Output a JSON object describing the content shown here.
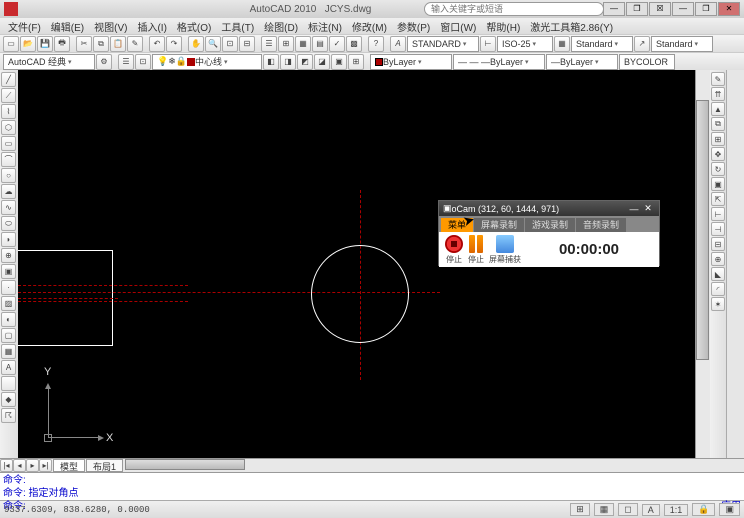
{
  "title": {
    "app": "AutoCAD 2010",
    "file": "JCYS.dwg"
  },
  "search": {
    "placeholder": "输入关键字或短语"
  },
  "menu": {
    "items": [
      "文件(F)",
      "编辑(E)",
      "视图(V)",
      "插入(I)",
      "格式(O)",
      "工具(T)",
      "绘图(D)",
      "标注(N)",
      "修改(M)",
      "参数(P)",
      "窗口(W)",
      "帮助(H)",
      "激光工具箱2.86(Y)"
    ]
  },
  "toolbar2": {
    "workspace": "AutoCAD 经典",
    "layer": "中心线",
    "bylayer1": "ByLayer",
    "bylayer2": "ByLayer",
    "bylayer3": "ByLayer",
    "bycolor": "BYCOLOR"
  },
  "styles": {
    "text": "STANDARD",
    "dim": "ISO-25",
    "table": "Standard",
    "mleader": "Standard"
  },
  "tabs": {
    "model": "模型",
    "layout1": "布局1"
  },
  "cmd": {
    "l1": "命令:",
    "l2": "命令: 指定对角点",
    "l3": "命令:",
    "l4": "应用"
  },
  "status": {
    "coords": "9337.6309, 838.6280, 0.0000",
    "scale": "1:1",
    "annot": "A"
  },
  "ucs": {
    "x": "X",
    "y": "Y"
  },
  "ocam": {
    "title": "oCam (312, 60, 1444, 971)",
    "tabs": [
      "菜单",
      "屏幕录制",
      "游戏录制",
      "音频录制"
    ],
    "btns": {
      "stop": "停止",
      "pause": "停止",
      "cap": "屏幕捕获"
    },
    "timer": "00:00:00"
  },
  "chart_data": {
    "type": "other"
  }
}
